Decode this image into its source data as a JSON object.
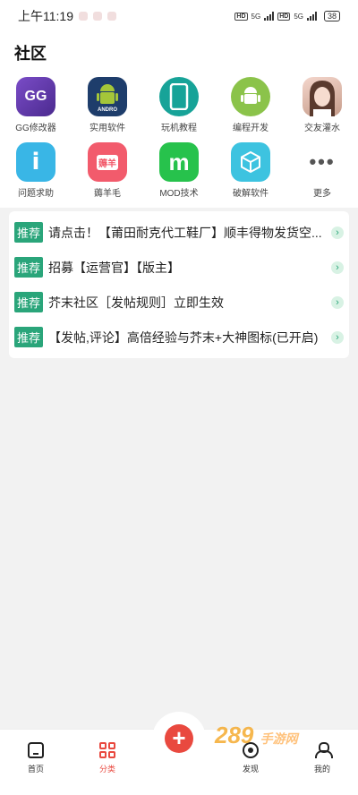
{
  "status_bar": {
    "time": "上午11:19",
    "network_a": "5G",
    "network_b": "5G",
    "hd": "HD",
    "battery": "38"
  },
  "page": {
    "title": "社区"
  },
  "categories": [
    {
      "label": "GG修改器",
      "icon": "gg-modifier-icon",
      "glyph": "GG"
    },
    {
      "label": "实用软件",
      "icon": "android-utility-icon",
      "glyph": "ANDRO"
    },
    {
      "label": "玩机教程",
      "icon": "phone-tutorial-icon",
      "glyph": "▯"
    },
    {
      "label": "编程开发",
      "icon": "android-dev-icon",
      "glyph": "⚙"
    },
    {
      "label": "交友灌水",
      "icon": "social-avatar-icon",
      "glyph": ""
    },
    {
      "label": "问题求助",
      "icon": "help-info-icon",
      "glyph": "i"
    },
    {
      "label": "薅羊毛",
      "icon": "freebie-bag-icon",
      "glyph": "薅羊"
    },
    {
      "label": "MOD技术",
      "icon": "mod-m-icon",
      "glyph": "m"
    },
    {
      "label": "破解软件",
      "icon": "cube-icon",
      "glyph": "⬡"
    },
    {
      "label": "更多",
      "icon": "more-dots-icon",
      "glyph": "•••"
    }
  ],
  "recommended": {
    "tag_label": "推荐",
    "items": [
      {
        "text": "请点击！【莆田耐克代工鞋厂】顺丰得物发货空..."
      },
      {
        "text": "招募【运营官】【版主】"
      },
      {
        "text": "芥末社区［发帖规则］立即生效"
      },
      {
        "text": "【发帖,评论】高倍经验与芥末+大神图标(已开启)"
      }
    ]
  },
  "bottom_nav": {
    "home": "首页",
    "category": "分类",
    "discover": "发现",
    "mine": "我的"
  },
  "watermark": {
    "text": "289",
    "sub": "手游网"
  },
  "colors": {
    "accent_red": "#e9493f",
    "tag_green": "#2aa57a"
  }
}
